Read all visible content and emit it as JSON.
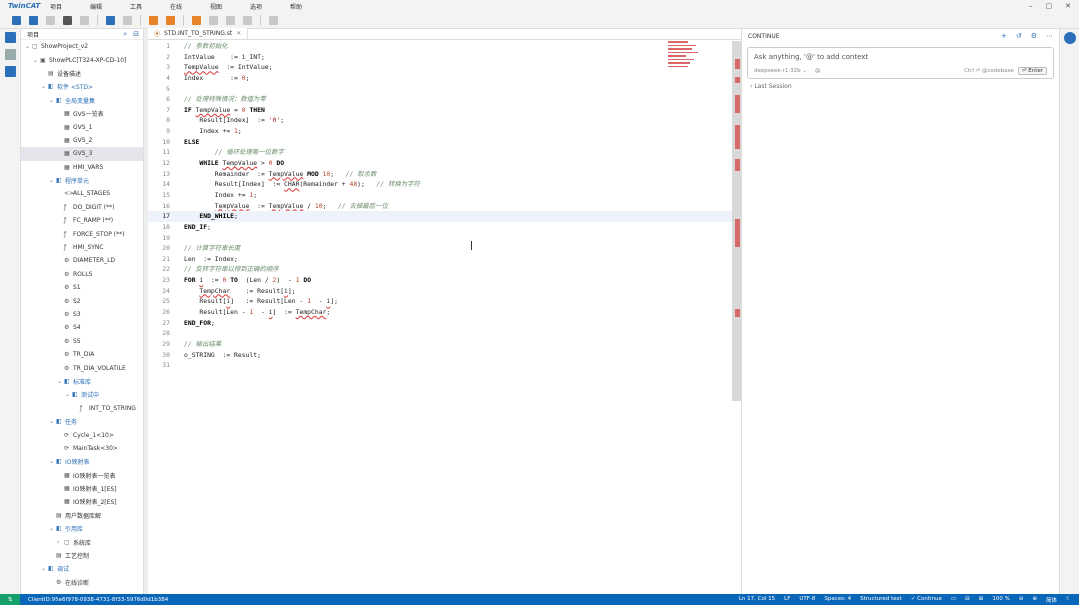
{
  "menu": {
    "logo": "TwinCAT",
    "items": [
      "项目",
      "编辑",
      "工具",
      "在线",
      "视图",
      "选项",
      "帮助"
    ]
  },
  "tree": {
    "title": "项目",
    "rows": [
      {
        "indent": 0,
        "tw": "⌄",
        "icon": "▢",
        "label": "ShowProject_v2"
      },
      {
        "indent": 1,
        "tw": "⌄",
        "icon": "▣",
        "label": "ShowPLC[T324-XP-CD-10]"
      },
      {
        "indent": 2,
        "tw": "",
        "icon": "▤",
        "label": "设备描述"
      },
      {
        "indent": 2,
        "tw": "⌄",
        "icon": "◧",
        "label": "软件 <STD>",
        "blue": true
      },
      {
        "indent": 3,
        "tw": "⌄",
        "icon": "◧",
        "label": "全局变量集",
        "blue": true
      },
      {
        "indent": 4,
        "tw": "",
        "icon": "▦",
        "label": "GVS一览表"
      },
      {
        "indent": 4,
        "tw": "",
        "icon": "▦",
        "label": "GVS_1"
      },
      {
        "indent": 4,
        "tw": "",
        "icon": "▦",
        "label": "GVS_2"
      },
      {
        "indent": 4,
        "tw": "",
        "icon": "▦",
        "label": "GVS_3",
        "selected": true
      },
      {
        "indent": 4,
        "tw": "",
        "icon": "▦",
        "label": "HMI_VARS"
      },
      {
        "indent": 3,
        "tw": "⌄",
        "icon": "◧",
        "label": "程序单元",
        "blue": true
      },
      {
        "indent": 4,
        "tw": "",
        "icon": "<>",
        "label": "ALL_STAGES"
      },
      {
        "indent": 4,
        "tw": "",
        "icon": "ƒ",
        "label": "DO_DIGIT (**)"
      },
      {
        "indent": 4,
        "tw": "",
        "icon": "ƒ",
        "label": "FC_RAMP (**)"
      },
      {
        "indent": 4,
        "tw": "",
        "icon": "ƒ",
        "label": "FORCE_STOP (**)"
      },
      {
        "indent": 4,
        "tw": "",
        "icon": "ƒ",
        "label": "HMI_SYNC"
      },
      {
        "indent": 4,
        "tw": "",
        "icon": "⚙",
        "label": "DIAMETER_LD"
      },
      {
        "indent": 4,
        "tw": "",
        "icon": "⚙",
        "label": "ROLLS"
      },
      {
        "indent": 4,
        "tw": "",
        "icon": "⚙",
        "label": "S1"
      },
      {
        "indent": 4,
        "tw": "",
        "icon": "⚙",
        "label": "S2"
      },
      {
        "indent": 4,
        "tw": "",
        "icon": "⚙",
        "label": "S3"
      },
      {
        "indent": 4,
        "tw": "",
        "icon": "⚙",
        "label": "S4"
      },
      {
        "indent": 4,
        "tw": "",
        "icon": "⚙",
        "label": "S5"
      },
      {
        "indent": 4,
        "tw": "",
        "icon": "⚙",
        "label": "TR_DIA"
      },
      {
        "indent": 4,
        "tw": "",
        "icon": "⚙",
        "label": "TR_DIA_VOLATILE"
      },
      {
        "indent": 4,
        "tw": "⌄",
        "icon": "◧",
        "label": "标准库",
        "blue": true
      },
      {
        "indent": 5,
        "tw": "⌄",
        "icon": "◧",
        "label": "测试中",
        "blue": true
      },
      {
        "indent": 6,
        "tw": "",
        "icon": "ƒ",
        "label": "INT_TO_STRING"
      },
      {
        "indent": 3,
        "tw": "⌄",
        "icon": "◧",
        "label": "任务",
        "blue": true
      },
      {
        "indent": 4,
        "tw": "",
        "icon": "⟳",
        "label": "Cycle_1<10>"
      },
      {
        "indent": 4,
        "tw": "",
        "icon": "⟳",
        "label": "MainTask<30>"
      },
      {
        "indent": 3,
        "tw": "⌄",
        "icon": "◧",
        "label": "IO映射表",
        "blue": true
      },
      {
        "indent": 4,
        "tw": "",
        "icon": "▦",
        "label": "IO映射表一览表"
      },
      {
        "indent": 4,
        "tw": "",
        "icon": "▦",
        "label": "IO映射表_1[ES]"
      },
      {
        "indent": 4,
        "tw": "",
        "icon": "▦",
        "label": "IO映射表_2[ES]"
      },
      {
        "indent": 3,
        "tw": "",
        "icon": "▤",
        "label": "用户数据库解"
      },
      {
        "indent": 3,
        "tw": "⌄",
        "icon": "◧",
        "label": "引用库",
        "blue": true
      },
      {
        "indent": 4,
        "tw": "›",
        "icon": "▢",
        "label": "系统库"
      },
      {
        "indent": 3,
        "tw": "",
        "icon": "▤",
        "label": "工艺控制"
      },
      {
        "indent": 2,
        "tw": "⌄",
        "icon": "◧",
        "label": "调试",
        "blue": true
      },
      {
        "indent": 3,
        "tw": "",
        "icon": "⚙",
        "label": "在线诊断"
      }
    ]
  },
  "editor": {
    "tab": "STD.INT_TO_STRING.st",
    "lines": [
      [
        {
          "t": "// 参数初始化",
          "c": "cm"
        }
      ],
      [
        {
          "t": "IntValue    := i_INT;",
          "c": "id"
        }
      ],
      [
        {
          "t": "TempValue",
          "c": "id squig"
        },
        {
          "t": "  := IntValue;",
          "c": "id"
        }
      ],
      [
        {
          "t": "Index       := ",
          "c": "id"
        },
        {
          "t": "0",
          "c": "num"
        },
        {
          "t": ";",
          "c": "id"
        }
      ],
      [],
      [
        {
          "t": "// 处理特殊情况：数值为零",
          "c": "cm"
        }
      ],
      [
        {
          "t": "IF ",
          "c": "kw"
        },
        {
          "t": "TempValue",
          "c": "id squig"
        },
        {
          "t": " = ",
          "c": "id"
        },
        {
          "t": "0",
          "c": "num"
        },
        {
          "t": " THEN",
          "c": "kw"
        }
      ],
      [
        {
          "t": "    Result[Index]  := ",
          "c": "id"
        },
        {
          "t": "'0'",
          "c": "str"
        },
        {
          "t": ";",
          "c": "id"
        }
      ],
      [
        {
          "t": "    Index += ",
          "c": "id"
        },
        {
          "t": "1",
          "c": "num"
        },
        {
          "t": ";",
          "c": "id"
        }
      ],
      [
        {
          "t": "ELSE",
          "c": "kw"
        }
      ],
      [
        {
          "t": "        // 循环处理每一位数字",
          "c": "cm"
        }
      ],
      [
        {
          "t": "    WHILE ",
          "c": "kw"
        },
        {
          "t": "TempValue",
          "c": "id squig"
        },
        {
          "t": " > ",
          "c": "id"
        },
        {
          "t": "0",
          "c": "num"
        },
        {
          "t": " DO",
          "c": "kw"
        }
      ],
      [
        {
          "t": "        Remainder  := ",
          "c": "id"
        },
        {
          "t": "TempValue",
          "c": "id squig"
        },
        {
          "t": " MOD ",
          "c": "kw"
        },
        {
          "t": "10",
          "c": "num"
        },
        {
          "t": ";   ",
          "c": "id"
        },
        {
          "t": "// 取余数",
          "c": "cm"
        }
      ],
      [
        {
          "t": "        Result[Index]  := ",
          "c": "id"
        },
        {
          "t": "CHAR",
          "c": "id squig"
        },
        {
          "t": "(Remainder + ",
          "c": "id"
        },
        {
          "t": "48",
          "c": "num"
        },
        {
          "t": ");   ",
          "c": "id"
        },
        {
          "t": "// 转换为字符",
          "c": "cm"
        }
      ],
      [
        {
          "t": "        Index += ",
          "c": "id"
        },
        {
          "t": "1",
          "c": "num"
        },
        {
          "t": ";",
          "c": "id"
        }
      ],
      [
        {
          "t": "        ",
          "c": "id"
        },
        {
          "t": "TempValue",
          "c": "id squig"
        },
        {
          "t": "  := ",
          "c": "id"
        },
        {
          "t": "TempValue",
          "c": "id squig"
        },
        {
          "t": " / ",
          "c": "id"
        },
        {
          "t": "10",
          "c": "num"
        },
        {
          "t": ";   ",
          "c": "id"
        },
        {
          "t": "// 去掉最后一位",
          "c": "cm"
        }
      ],
      [
        {
          "t": "    END_WHILE",
          "c": "kw"
        },
        {
          "t": ";",
          "c": "id"
        }
      ],
      [
        {
          "t": "END_IF",
          "c": "kw"
        },
        {
          "t": ";",
          "c": "id"
        }
      ],
      [],
      [
        {
          "t": "// 计算字符串长度",
          "c": "cm"
        }
      ],
      [
        {
          "t": "Len  := Index;",
          "c": "id"
        }
      ],
      [
        {
          "t": "// 反转字符串以得到正确的顺序",
          "c": "cm"
        }
      ],
      [
        {
          "t": "FOR ",
          "c": "kw"
        },
        {
          "t": "i",
          "c": "id squig"
        },
        {
          "t": "  := ",
          "c": "id"
        },
        {
          "t": "0",
          "c": "num"
        },
        {
          "t": " TO ",
          "c": "kw"
        },
        {
          "t": " (Len / ",
          "c": "id"
        },
        {
          "t": "2",
          "c": "num"
        },
        {
          "t": ")  - ",
          "c": "id"
        },
        {
          "t": "1",
          "c": "num"
        },
        {
          "t": " DO",
          "c": "kw"
        }
      ],
      [
        {
          "t": "    ",
          "c": "id"
        },
        {
          "t": "TempChar",
          "c": "id squig"
        },
        {
          "t": "    := Result[",
          "c": "id"
        },
        {
          "t": "i",
          "c": "id squig"
        },
        {
          "t": "];",
          "c": "id"
        }
      ],
      [
        {
          "t": "    Result[",
          "c": "id"
        },
        {
          "t": "i",
          "c": "id squig"
        },
        {
          "t": "]   := Result[Len - ",
          "c": "id"
        },
        {
          "t": "1",
          "c": "num"
        },
        {
          "t": "  - ",
          "c": "id"
        },
        {
          "t": "i",
          "c": "id squig"
        },
        {
          "t": "];",
          "c": "id"
        }
      ],
      [
        {
          "t": "    Result[Len - ",
          "c": "id"
        },
        {
          "t": "1",
          "c": "num"
        },
        {
          "t": "  - ",
          "c": "id"
        },
        {
          "t": "i",
          "c": "id squig"
        },
        {
          "t": "]  := ",
          "c": "id"
        },
        {
          "t": "TempChar",
          "c": "id squig"
        },
        {
          "t": ";",
          "c": "id"
        }
      ],
      [
        {
          "t": "END_FOR",
          "c": "kw"
        },
        {
          "t": ";",
          "c": "id"
        }
      ],
      [],
      [
        {
          "t": "// 输出结果",
          "c": "cm"
        }
      ],
      [
        {
          "t": "o_STRING  := Result;",
          "c": "id"
        }
      ],
      []
    ],
    "current_line": 17
  },
  "chat": {
    "title": "CONTINUE",
    "placeholder": "Ask anything, '@' to add context",
    "model": "deepseek-r1:32b ⌄",
    "at": "@",
    "shortcut": "Ctrl ⏎ @codebase",
    "enter": "⏎ Enter",
    "last_session": "Last Session"
  },
  "status": {
    "client": "ClientID:95e6f978-0938-4731-8f33-5976d0d1b384",
    "right": [
      "Ln 17, Col 15",
      "LF",
      "UTF-8",
      "Spaces: 4",
      "Structured text",
      "✓ Continue",
      "▭",
      "⊟",
      "⊞",
      "100 %",
      "⊖",
      "⊕",
      "简体",
      "☾"
    ]
  }
}
